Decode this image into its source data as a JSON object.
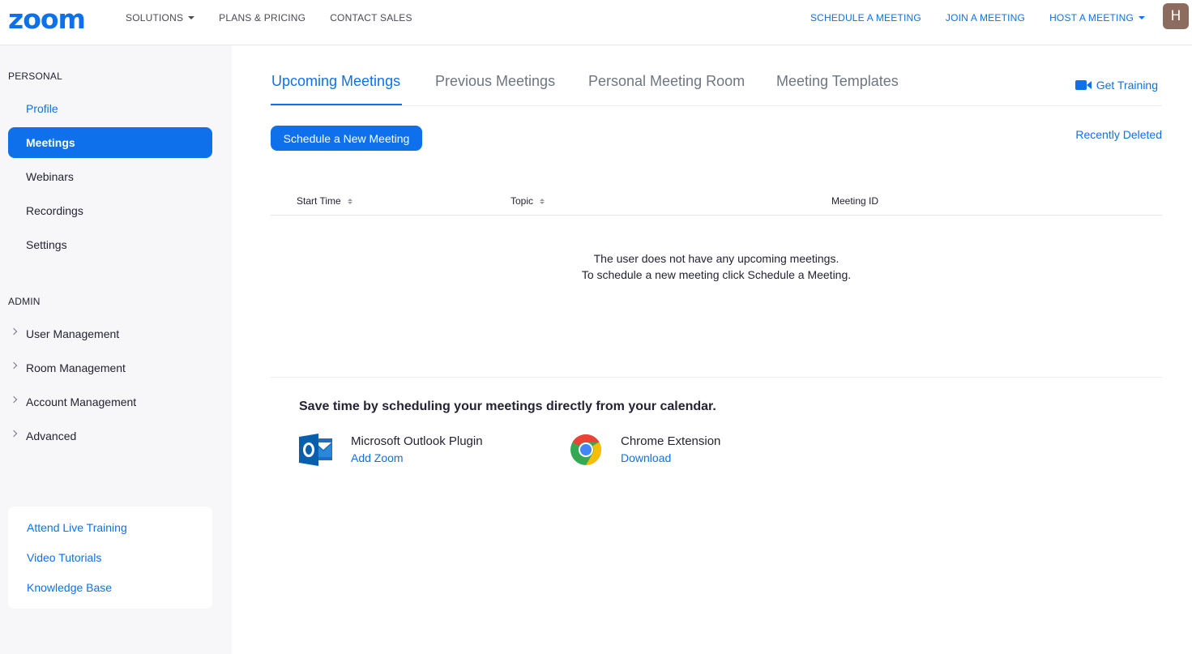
{
  "app": {
    "logo_text": "zoom",
    "brand_color": "#0e71eb",
    "avatar_initial": "H"
  },
  "topnav": {
    "left": [
      {
        "label": "SOLUTIONS",
        "has_dropdown": true
      },
      {
        "label": "PLANS & PRICING"
      },
      {
        "label": "CONTACT SALES"
      }
    ],
    "right": [
      {
        "label": "SCHEDULE A MEETING"
      },
      {
        "label": "JOIN A MEETING"
      },
      {
        "label": "HOST A MEETING",
        "has_dropdown": true
      }
    ]
  },
  "sidebar": {
    "personal_title": "PERSONAL",
    "personal_items": [
      {
        "label": "Profile",
        "state": "link"
      },
      {
        "label": "Meetings",
        "state": "active"
      },
      {
        "label": "Webinars"
      },
      {
        "label": "Recordings"
      },
      {
        "label": "Settings"
      }
    ],
    "admin_title": "ADMIN",
    "admin_items": [
      {
        "label": "User Management"
      },
      {
        "label": "Room Management"
      },
      {
        "label": "Account Management"
      },
      {
        "label": "Advanced"
      }
    ],
    "help_links": [
      {
        "label": "Attend Live Training"
      },
      {
        "label": "Video Tutorials"
      },
      {
        "label": "Knowledge Base"
      }
    ]
  },
  "main": {
    "tabs": [
      {
        "label": "Upcoming Meetings",
        "active": true
      },
      {
        "label": "Previous Meetings"
      },
      {
        "label": "Personal Meeting Room"
      },
      {
        "label": "Meeting Templates"
      }
    ],
    "get_training": "Get Training",
    "schedule_button": "Schedule a New Meeting",
    "recently_deleted": "Recently Deleted",
    "table_headers": [
      {
        "label": "Start Time",
        "sortable": true
      },
      {
        "label": "Topic",
        "sortable": true
      },
      {
        "label": "Meeting ID",
        "sortable": false
      }
    ],
    "empty_line1": "The user does not have any upcoming meetings.",
    "empty_line2": "To schedule a new meeting click Schedule a Meeting.",
    "calendar_title": "Save time by scheduling your meetings directly from your calendar.",
    "plugins": [
      {
        "name": "Microsoft Outlook Plugin",
        "action": "Add Zoom",
        "icon": "outlook-icon"
      },
      {
        "name": "Chrome Extension",
        "action": "Download",
        "icon": "chrome-icon"
      }
    ]
  }
}
